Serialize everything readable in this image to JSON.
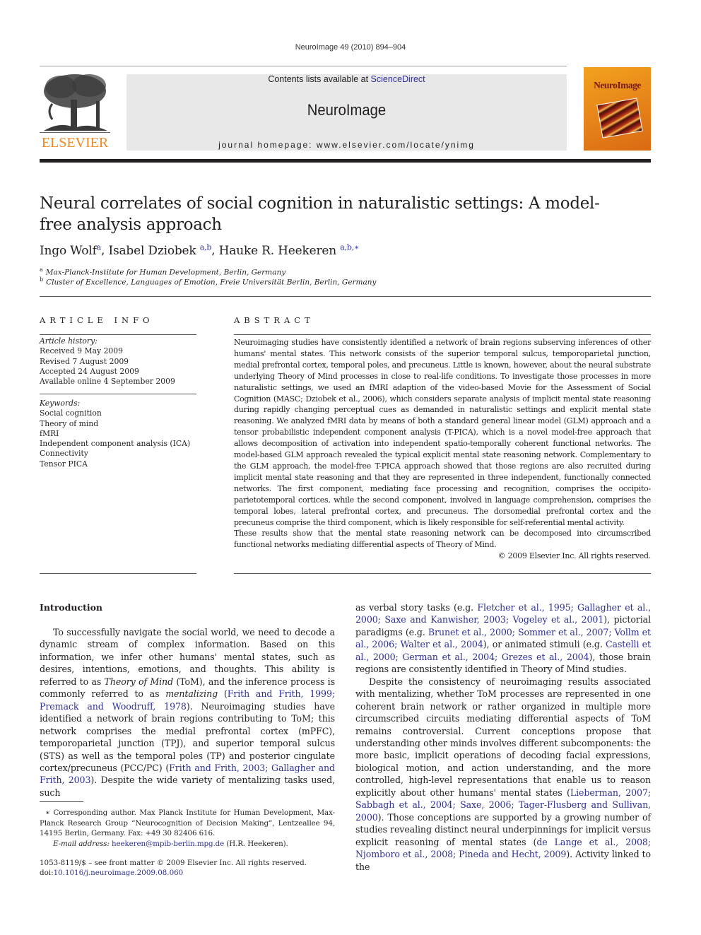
{
  "header": {
    "running_head": "NeuroImage 49 (2010) 894–904",
    "publisher_logo_text": "ELSEVIER",
    "contents_prefix": "Contents lists available at ",
    "contents_link": "ScienceDirect",
    "journal_name": "NeuroImage",
    "homepage": "journal homepage: www.elsevier.com/locate/ynimg",
    "cover_title": "NeuroImage"
  },
  "article": {
    "title": "Neural correlates of social cognition in naturalistic settings: A model-free analysis approach",
    "authors": [
      {
        "name": "Ingo Wolf",
        "sup": "a",
        "sep": ", "
      },
      {
        "name": "Isabel Dziobek",
        "sup": "a,b",
        "sep": ", "
      },
      {
        "name": "Hauke R. Heekeren",
        "sup": "a,b,∗",
        "sep": ""
      }
    ],
    "affiliations": [
      {
        "mark": "a",
        "text": "Max-Planck-Institute for Human Development, Berlin, Germany"
      },
      {
        "mark": "b",
        "text": "Cluster of Excellence, Languages of Emotion, Freie Universität Berlin, Berlin, Germany"
      }
    ]
  },
  "article_info": {
    "heading": "ARTICLE INFO",
    "history_label": "Article history:",
    "history": [
      "Received 9 May 2009",
      "Revised 7 August 2009",
      "Accepted 24 August 2009",
      "Available online 4 September 2009"
    ],
    "keywords_label": "Keywords:",
    "keywords": [
      "Social cognition",
      "Theory of mind",
      "fMRI",
      "Independent component analysis (ICA)",
      "Connectivity",
      "Tensor PICA"
    ]
  },
  "abstract": {
    "heading": "ABSTRACT",
    "paragraph1": "Neuroimaging studies have consistently identified a network of brain regions subserving inferences of other humans' mental states. This network consists of the superior temporal sulcus, temporoparietal junction, medial prefrontal cortex, temporal poles, and precuneus. Little is known, however, about the neural substrate underlying Theory of Mind processes in close to real-life conditions. To investigate those processes in more naturalistic settings, we used an fMRI adaption of the video-based Movie for the Assessment of Social Cognition (MASC; Dziobek et al., 2006), which considers separate analysis of implicit mental state reasoning during rapidly changing perceptual cues as demanded in naturalistic settings and explicit mental state reasoning. We analyzed fMRI data by means of both a standard general linear model (GLM) approach and a tensor probabilistic independent component analysis (T-PICA), which is a novel model-free approach that allows decomposition of activation into independent spatio-temporally coherent functional networks. The model-based GLM approach revealed the typical explicit mental state reasoning network. Complementary to the GLM approach, the model-free T-PICA approach showed that those regions are also recruited during implicit mental state reasoning and that they are represented in three independent, functionally connected networks. The first component, mediating face processing and recognition, comprises the occipito-parietotemporal cortices, while the second component, involved in language comprehension, comprises the temporal lobes, lateral prefrontal cortex, and precuneus. The dorsomedial prefrontal cortex and the precuneus comprise the third component, which is likely responsible for self-referential mental activity.",
    "paragraph2": "These results show that the mental state reasoning network can be decomposed into circumscribed functional networks mediating differential aspects of Theory of Mind.",
    "copyright": "© 2009 Elsevier Inc. All rights reserved."
  },
  "body": {
    "section_heading": "Introduction",
    "left_column": [
      {
        "t": "To successfully navigate the social world, we need to decode a dynamic stream of complex information. Based on this information, we infer other humans' mental states, such as desires, intentions, emotions, and thoughts. This ability is referred to as "
      },
      {
        "t": "Theory of Mind",
        "style": "italic"
      },
      {
        "t": " (ToM), and the inference process is commonly referred to as "
      },
      {
        "t": "mentalizing",
        "style": "italic"
      },
      {
        "t": " ("
      },
      {
        "t": "Frith and Frith, 1999; Premack and Woodruff, 1978",
        "style": "link"
      },
      {
        "t": "). Neuroimaging studies have identified a network of brain regions contributing to ToM; this network comprises the medial prefrontal cortex (mPFC), temporoparietal junction (TPJ), and superior temporal sulcus (STS) as well as the temporal poles (TP) and posterior cingulate cortex/precuneus (PCC/PC) ("
      },
      {
        "t": "Frith and Frith, 2003; Gallagher and Frith, 2003",
        "style": "link"
      },
      {
        "t": "). Despite the wide variety of mentalizing tasks used, such"
      }
    ],
    "right_column_p1": [
      {
        "t": "as verbal story tasks (e.g. "
      },
      {
        "t": "Fletcher et al., 1995; Gallagher et al., 2000; Saxe and Kanwisher, 2003; Vogeley et al., 2001",
        "style": "link"
      },
      {
        "t": "), pictorial paradigms (e.g. "
      },
      {
        "t": "Brunet et al., 2000; Sommer et al., 2007; Vollm et al., 2006; Walter et al., 2004",
        "style": "link"
      },
      {
        "t": "), or animated stimuli (e.g. "
      },
      {
        "t": "Castelli et al., 2000; German et al., 2004; Grezes et al., 2004",
        "style": "link"
      },
      {
        "t": "), those brain regions are consistently identified in Theory of Mind studies."
      }
    ],
    "right_column_p2": [
      {
        "t": "Despite the consistency of neuroimaging results associated with mentalizing, whether ToM processes are represented in one coherent brain network or rather organized in multiple more circumscribed circuits mediating differential aspects of ToM remains controversial. Current conceptions propose that understanding other minds involves different subcomponents: the more basic, implicit operations of decoding facial expressions, biological motion, and action understanding, and the more controlled, high-level representations that enable us to reason explicitly about other humans' mental states ("
      },
      {
        "t": "Lieberman, 2007; Sabbagh et al., 2004; Saxe, 2006; Tager-Flusberg and Sullivan, 2000",
        "style": "link"
      },
      {
        "t": "). Those conceptions are supported by a growing number of studies revealing distinct neural underpinnings for implicit versus explicit reasoning of mental states ("
      },
      {
        "t": "de Lange et al., 2008; Njomboro et al., 2008; Pineda and Hecht, 2009",
        "style": "link"
      },
      {
        "t": "). Activity linked to the"
      }
    ]
  },
  "footnote": {
    "mark": "∗",
    "text": " Corresponding author. Max Planck Institute for Human Development, Max-Planck Research Group “Neurocognition of Decision Making”, Lentzeallee 94, 14195 Berlin, Germany. Fax: +49 30 82406 616.",
    "email_label": "E-mail address:",
    "email": "heekeren@mpib-berlin.mpg.de",
    "email_suffix": " (H.R. Heekeren)."
  },
  "front_matter": {
    "issn_line": "1053-8119/$ – see front matter © 2009 Elsevier Inc. All rights reserved.",
    "doi_prefix": "doi:",
    "doi": "10.1016/j.neuroimage.2009.08.060"
  },
  "colors": {
    "link": "#2e3192",
    "elsevier_orange": "#f08a24",
    "masthead_bg": "#e8e8e8"
  }
}
